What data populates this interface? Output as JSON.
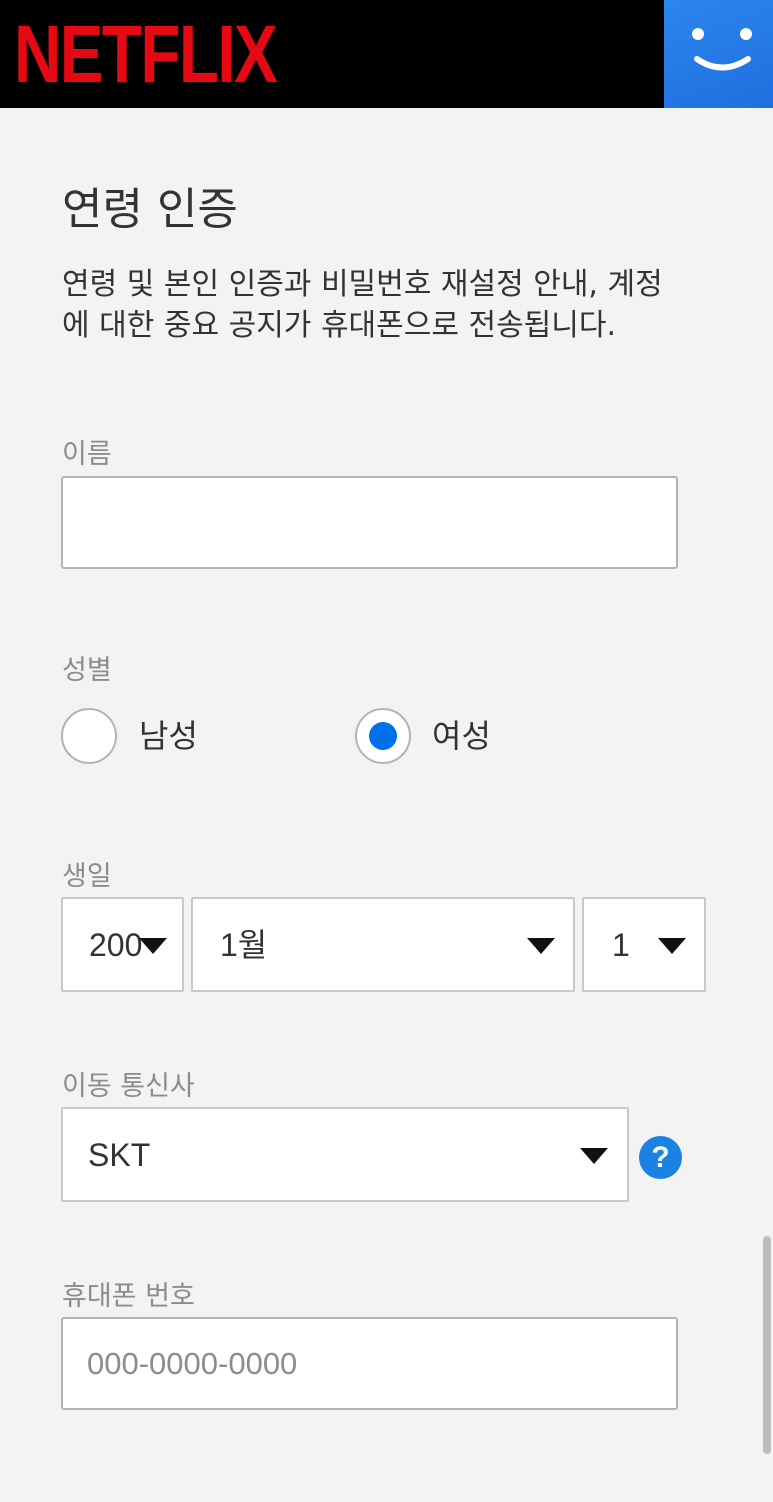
{
  "header": {
    "logo_text": "NETFLIX",
    "brand_color": "#e50914",
    "avatar_icon": "smiley-face-icon",
    "avatar_color": "#2b86ee"
  },
  "page": {
    "title": "연령 인증",
    "description": "연령 및 본인 인증과 비밀번호 재설정 안내, 계정에 대한 중요 공지가 휴대폰으로 전송됩니다."
  },
  "name_field": {
    "label": "이름",
    "value": ""
  },
  "gender": {
    "label": "성별",
    "options": [
      {
        "label": "남성",
        "selected": false
      },
      {
        "label": "여성",
        "selected": true
      }
    ],
    "selected_color": "#0071eb"
  },
  "birthday": {
    "label": "생일",
    "year": "200",
    "month": "1월",
    "day": "1"
  },
  "carrier": {
    "label": "이동 통신사",
    "value": "SKT",
    "help_icon": "help-question-icon",
    "help_text": "?"
  },
  "phone": {
    "label": "휴대폰 번호",
    "placeholder": "000-0000-0000"
  }
}
